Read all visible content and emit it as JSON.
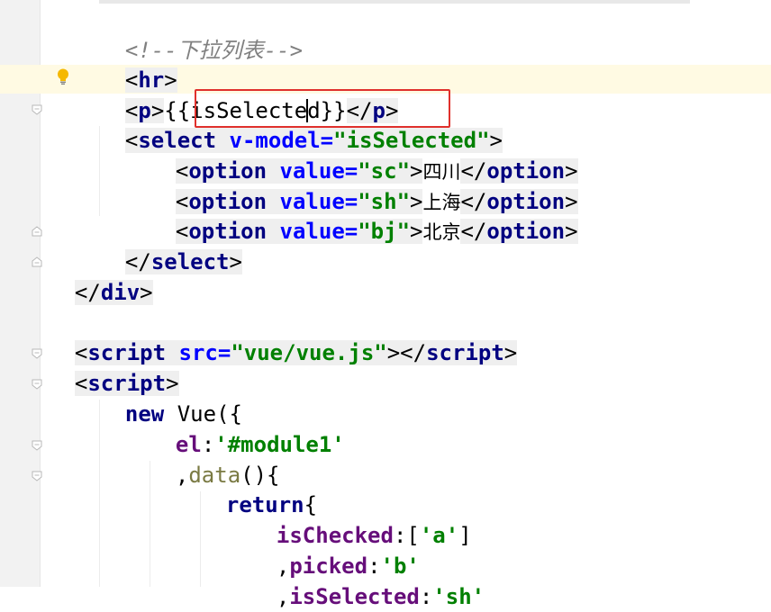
{
  "editor": {
    "comment": "<!--下拉列表-->",
    "hr_line": [
      "<",
      "hr",
      ">"
    ],
    "p_line": {
      "open": "<",
      "tag": "p",
      "close": ">",
      "before_caret": "{{isSelecte",
      "after_caret": "d}}",
      "end_open": "</",
      "end_tag": "p",
      "end_close": ">"
    },
    "select_line": {
      "lt": "<",
      "tag": "select",
      "attr": "v-model",
      "eq": "=",
      "value": "\"isSelected\"",
      "gt": ">"
    },
    "options": [
      {
        "lt": "<",
        "tag": "option",
        "attr": "value",
        "eq": "=",
        "value": "\"sc\"",
        "gt": ">",
        "text": "四川",
        "end_lt": "</",
        "end_tag": "option",
        "end_gt": ">"
      },
      {
        "lt": "<",
        "tag": "option",
        "attr": "value",
        "eq": "=",
        "value": "\"sh\"",
        "gt": ">",
        "text": "上海",
        "end_lt": "</",
        "end_tag": "option",
        "end_gt": ">"
      },
      {
        "lt": "<",
        "tag": "option",
        "attr": "value",
        "eq": "=",
        "value": "\"bj\"",
        "gt": ">",
        "text": "北京",
        "end_lt": "</",
        "end_tag": "option",
        "end_gt": ">"
      }
    ],
    "select_close": [
      "</",
      "select",
      ">"
    ],
    "div_close": [
      "</",
      "div",
      ">"
    ],
    "script_src_line": {
      "lt": "<",
      "tag": "script",
      "attr": "src",
      "eq": "=",
      "value": "\"vue/vue.js\"",
      "gt": ">",
      "end_lt": "</",
      "end_tag": "script",
      "end_gt": ">"
    },
    "script_open": [
      "<",
      "script",
      ">"
    ],
    "new_vue": {
      "kw": "new",
      "rest": " Vue({"
    },
    "el_line": {
      "key": "el",
      "colon": ":",
      "value": "'#module1'"
    },
    "data_line": {
      "comma": ",",
      "fn": "data",
      "rest": "(){"
    },
    "return_line": {
      "kw": "return",
      "rest": "{"
    },
    "checked_line": {
      "key": "isChecked",
      "colon": ":[",
      "value": "'a'",
      "end": "]"
    },
    "picked_line": {
      "comma": ",",
      "key": "picked",
      "colon": ":",
      "value": "'b'"
    },
    "selected_line": {
      "comma": ",",
      "key": "isSelected",
      "colon": ":",
      "value": "'sh'"
    }
  },
  "icons": {
    "bulb": "lightbulb-icon",
    "fold": "fold-marker-icon"
  },
  "colors": {
    "tag": "#000080",
    "attr": "#0000ff",
    "string": "#008000",
    "comment": "#808080",
    "field": "#660e7a",
    "highlight_box": "#e0302c",
    "caret_line": "#fffae3"
  }
}
